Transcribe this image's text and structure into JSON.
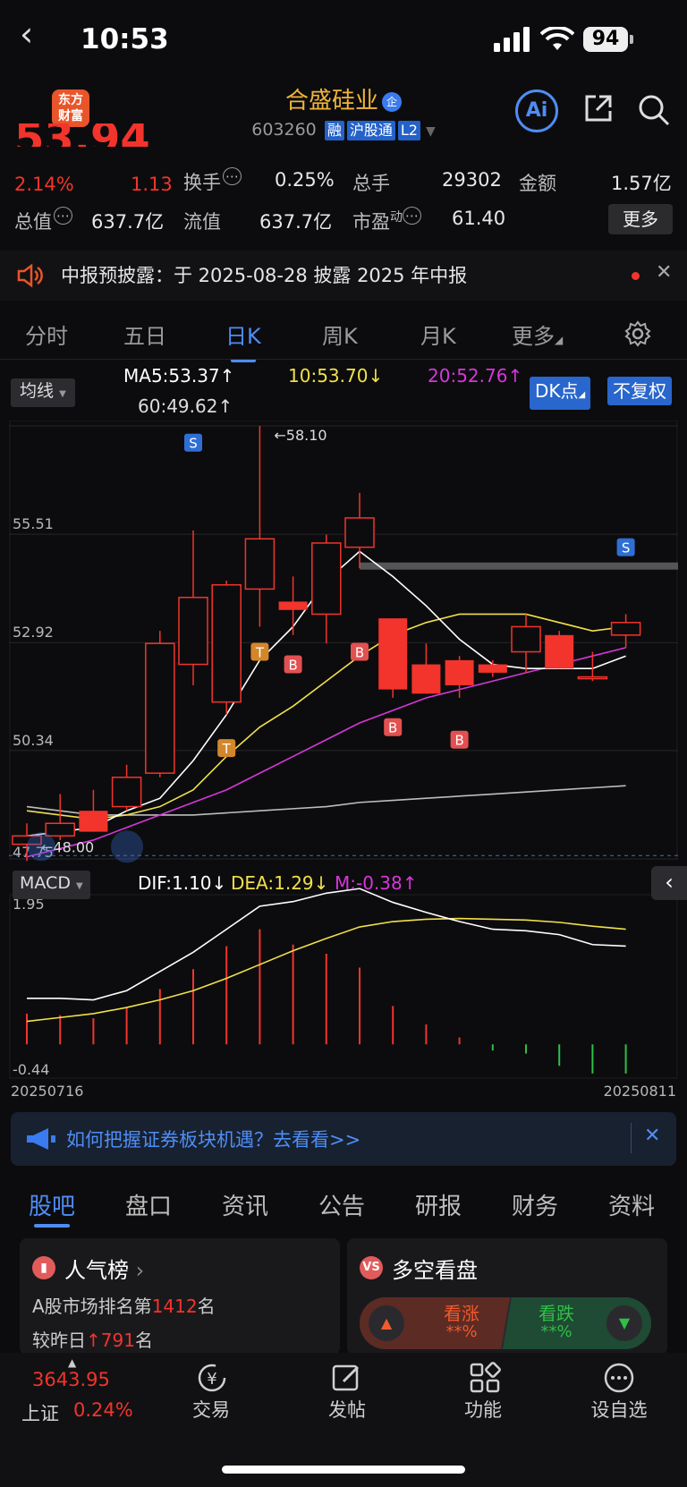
{
  "status_bar": {
    "time": "10:53",
    "battery": "94"
  },
  "header": {
    "logo_text": "东方\n财富",
    "stock_name": "合盛硅业",
    "badge": "企",
    "code": "603260",
    "tags": [
      "融",
      "沪股通",
      "L2"
    ],
    "ai_label": "Ai"
  },
  "quote": {
    "price_partial": "53.94",
    "change_pct": "2.14%",
    "change_amt": "1.13",
    "row1": [
      {
        "label": "换手",
        "value": "0.25%"
      },
      {
        "label": "总手",
        "value": "29302"
      },
      {
        "label": "金额",
        "value": "1.57亿"
      }
    ],
    "row2": [
      {
        "label": "总值",
        "value": "637.7亿"
      },
      {
        "label": "流值",
        "value": "637.7亿"
      },
      {
        "label": "市盈",
        "sup": "动",
        "value": "61.40"
      }
    ],
    "more_label": "更多"
  },
  "notice": {
    "text": "中报预披露：于 2025-08-28 披露 2025 年中报"
  },
  "tabs": [
    "分时",
    "五日",
    "日K",
    "周K",
    "月K",
    "更多"
  ],
  "indicator": {
    "ma_select": "均线",
    "ma5": "MA5:53.37",
    "ma10": "10:53.70",
    "ma20": "20:52.76",
    "ma60": "60:49.62",
    "dk_label": "DK点",
    "fq_label": "不复权",
    "macd_select": "MACD",
    "dif": "DIF:1.10",
    "dea": "DEA:1.29",
    "m": "M:-0.38"
  },
  "chart_data": {
    "type": "candlestick",
    "price_axis_labels": [
      "58.10",
      "55.51",
      "52.92",
      "50.34",
      "47.75"
    ],
    "high_marker": "←58.10",
    "low_marker": "←48.00",
    "macd_axis_labels": [
      "1.95",
      "-0.44"
    ],
    "date_start": "20250716",
    "date_end": "20250811",
    "candles": [
      {
        "o": 48.1,
        "c": 48.3,
        "h": 48.6,
        "l": 47.7
      },
      {
        "o": 48.3,
        "c": 48.6,
        "h": 49.3,
        "l": 48.2
      },
      {
        "o": 48.9,
        "c": 48.4,
        "h": 49.4,
        "l": 48.4
      },
      {
        "o": 49.0,
        "c": 49.7,
        "h": 50.0,
        "l": 48.9
      },
      {
        "o": 49.8,
        "c": 52.9,
        "h": 53.2,
        "l": 49.7
      },
      {
        "o": 52.4,
        "c": 54.0,
        "h": 55.6,
        "l": 51.9
      },
      {
        "o": 51.5,
        "c": 54.3,
        "h": 54.4,
        "l": 51.2
      },
      {
        "o": 54.2,
        "c": 55.4,
        "h": 58.1,
        "l": 53.3
      },
      {
        "o": 53.9,
        "c": 53.7,
        "h": 54.5,
        "l": 53.1
      },
      {
        "o": 53.6,
        "c": 55.3,
        "h": 55.5,
        "l": 52.9
      },
      {
        "o": 55.2,
        "c": 55.9,
        "h": 56.5,
        "l": 54.7
      },
      {
        "o": 53.5,
        "c": 51.8,
        "h": 53.5,
        "l": 51.6
      },
      {
        "o": 52.4,
        "c": 51.7,
        "h": 52.9,
        "l": 51.7
      },
      {
        "o": 52.5,
        "c": 51.9,
        "h": 52.6,
        "l": 51.6
      },
      {
        "o": 52.4,
        "c": 52.2,
        "h": 52.5,
        "l": 52.1
      },
      {
        "o": 52.7,
        "c": 53.3,
        "h": 53.6,
        "l": 52.2
      },
      {
        "o": 53.1,
        "c": 52.3,
        "h": 53.2,
        "l": 52.3
      },
      {
        "o": 52.1,
        "c": 52.1,
        "h": 52.7,
        "l": 52.0
      },
      {
        "o": 53.1,
        "c": 53.4,
        "h": 53.6,
        "l": 52.8
      }
    ],
    "ma5": [
      48.3,
      48.4,
      48.5,
      48.9,
      49.2,
      50.1,
      51.2,
      52.5,
      53.3,
      54.4,
      55.1,
      54.5,
      53.8,
      53.0,
      52.4,
      52.3,
      52.3,
      52.3,
      52.6
    ],
    "ma10": [
      48.9,
      48.8,
      48.7,
      48.8,
      49.0,
      49.4,
      50.2,
      50.9,
      51.4,
      52.0,
      52.6,
      53.1,
      53.4,
      53.6,
      53.6,
      53.6,
      53.4,
      53.2,
      53.3
    ],
    "ma20": [
      47.8,
      48.0,
      48.2,
      48.5,
      48.8,
      49.1,
      49.4,
      49.8,
      50.2,
      50.6,
      51.0,
      51.3,
      51.6,
      51.8,
      52.0,
      52.2,
      52.4,
      52.6,
      52.8
    ],
    "ma60": [
      49.0,
      48.9,
      48.8,
      48.8,
      48.8,
      48.8,
      48.85,
      48.9,
      48.95,
      49.0,
      49.1,
      49.15,
      49.2,
      49.25,
      49.3,
      49.35,
      49.4,
      49.45,
      49.5
    ],
    "signals": [
      {
        "i": 5,
        "t": "S",
        "price": 57.7
      },
      {
        "i": 6,
        "t": "T",
        "price": 50.4
      },
      {
        "i": 7,
        "t": "T",
        "price": 52.7
      },
      {
        "i": 8,
        "t": "B",
        "price": 52.4
      },
      {
        "i": 10,
        "t": "B",
        "price": 52.7
      },
      {
        "i": 11,
        "t": "B",
        "price": 50.9
      },
      {
        "i": 13,
        "t": "B",
        "price": 50.6
      },
      {
        "i": 18,
        "t": "S",
        "price": 55.2
      }
    ],
    "dif": [
      0.6,
      0.6,
      0.58,
      0.7,
      0.95,
      1.2,
      1.5,
      1.8,
      1.86,
      1.97,
      2.03,
      1.85,
      1.72,
      1.6,
      1.5,
      1.48,
      1.43,
      1.3,
      1.28
    ],
    "dea": [
      0.3,
      0.35,
      0.4,
      0.48,
      0.58,
      0.7,
      0.86,
      1.04,
      1.22,
      1.38,
      1.53,
      1.6,
      1.63,
      1.64,
      1.63,
      1.62,
      1.59,
      1.54,
      1.5
    ],
    "macd_bar": [
      0.4,
      0.38,
      0.34,
      0.48,
      0.72,
      0.98,
      1.28,
      1.5,
      1.3,
      1.18,
      1.0,
      0.5,
      0.26,
      0.09,
      -0.08,
      -0.12,
      -0.28,
      -0.38,
      -0.38
    ]
  },
  "ad": {
    "text": "如何把握证券板块机遇？去看看>>"
  },
  "subtabs": [
    "股吧",
    "盘口",
    "资讯",
    "公告",
    "研报",
    "财务",
    "资料"
  ],
  "popularity": {
    "title": "人气榜",
    "line1_pre": "A股市场排名第",
    "rank": "1412",
    "line1_post": "名",
    "line2_pre": "较昨日",
    "up": "791",
    "line2_post": "名"
  },
  "sentiment": {
    "title": "多空看盘",
    "bull": "看涨",
    "bear": "看跌",
    "bull_pct": "**%",
    "bear_pct": "**%"
  },
  "bottom": {
    "index_value": "3643.95",
    "index_name": "上证",
    "index_pct": "0.24%",
    "items": [
      "交易",
      "发帖",
      "功能",
      "设自选"
    ]
  },
  "colors": {
    "up": "#f2342c",
    "down": "#2fbf47",
    "accent": "#4f8df5",
    "ma5": "#ffffff",
    "ma10": "#f1e04a",
    "ma20": "#d637d9",
    "ma60": "#bdbdbd"
  }
}
